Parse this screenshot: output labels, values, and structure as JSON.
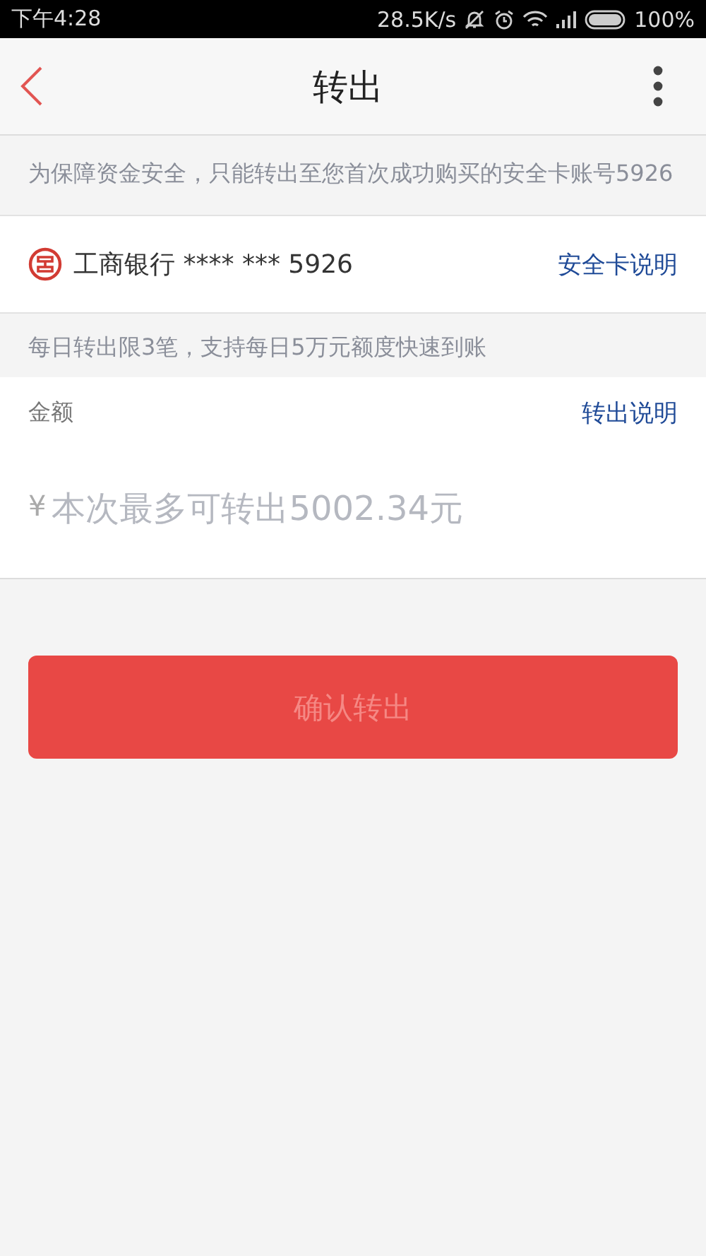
{
  "status_bar": {
    "time": "下午4:28",
    "speed": "28.5K/s",
    "battery": "100%"
  },
  "nav": {
    "title": "转出"
  },
  "notice": "为保障资金安全，只能转出至您首次成功购买的安全卡账号5926",
  "bank": {
    "name": "工商银行 **** *** 5926",
    "link": "安全卡说明"
  },
  "limit_note": "每日转出限3笔，支持每日5万元额度快速到账",
  "amount": {
    "label": "金额",
    "link": "转出说明",
    "currency": "¥",
    "placeholder": "本次最多可转出5002.34元"
  },
  "confirm_button": {
    "label": "确认转出",
    "disabled": true
  }
}
